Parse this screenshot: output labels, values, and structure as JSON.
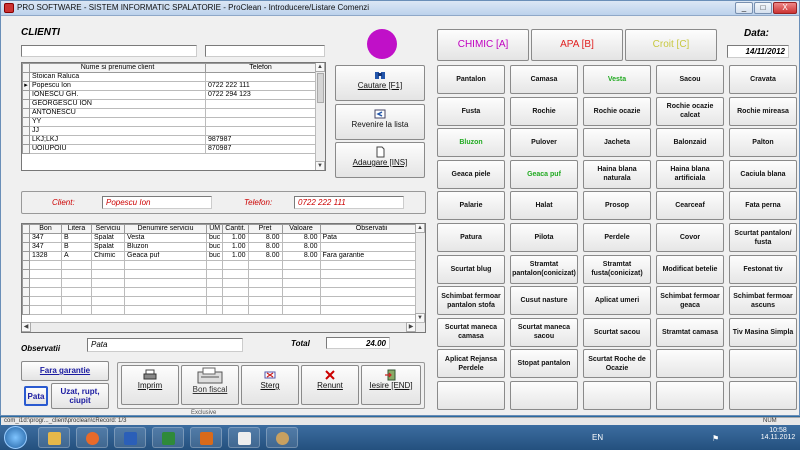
{
  "window": {
    "title": "PRO SOFTWARE - SISTEM INFORMATIC SPALATORIE - ProClean - Introducere/Listare Comenzi",
    "min": "_",
    "max": "□",
    "close": "X"
  },
  "clienti": {
    "title": "CLIENTI",
    "search1": "",
    "search2": "",
    "columns": [
      "Nume si prenume client",
      "Telefon"
    ],
    "rows": [
      {
        "name": "Stoican Raluca",
        "phone": ""
      },
      {
        "name": "Popescu Ion",
        "phone": "0722 222 111",
        "selected": true
      },
      {
        "name": "IONESCU GH.",
        "phone": "0722 294 123"
      },
      {
        "name": "GEORGESCU ION",
        "phone": ""
      },
      {
        "name": "ANTONESCU",
        "phone": ""
      },
      {
        "name": "YY",
        "phone": ""
      },
      {
        "name": "JJ",
        "phone": ""
      },
      {
        "name": "LKJ;LKJ",
        "phone": "987987"
      },
      {
        "name": "UOIUPOIU",
        "phone": "870987"
      }
    ],
    "btn_cautare": "Cautare [F1]",
    "btn_revenire": "Revenire la lista",
    "btn_adaugare": "Adaugare [INS]"
  },
  "client_info": {
    "client_label": "Client:",
    "client_value": "Popescu Ion",
    "telefon_label": "Telefon:",
    "telefon_value": "0722 222 111"
  },
  "orders": {
    "columns": [
      "Bon",
      "Litera",
      "Serviciu",
      "Denumire serviciu",
      "UM",
      "Cantit.",
      "Pret",
      "Valoare",
      "Observatii"
    ],
    "rows": [
      [
        "347",
        "B",
        "Spalat",
        "Vesta",
        "buc",
        "1.00",
        "8.00",
        "8.00",
        "Pata"
      ],
      [
        "347",
        "B",
        "Spalat",
        "Bluzon",
        "buc",
        "1.00",
        "8.00",
        "8.00",
        ""
      ],
      [
        "1328",
        "A",
        "Chimic",
        "Geaca puf",
        "buc",
        "1.00",
        "8.00",
        "8.00",
        "Fara garantie"
      ]
    ]
  },
  "observatii": {
    "label": "Observatii",
    "value": "Pata",
    "total_label": "Total",
    "total_value": "24.00"
  },
  "quick": {
    "fara_garantie": "Fara garantie",
    "pata": "Pata",
    "uzat": "Uzat, rupt, ciupit"
  },
  "actions": [
    "Imprim",
    "Bon fiscal",
    "Sterg",
    "Renunt",
    "Iesire [END]"
  ],
  "status_text": "Exclusive",
  "categories": [
    {
      "label": "CHIMIC [A]",
      "color": "#c000c0"
    },
    {
      "label": "APA [B]",
      "color": "#e02020"
    },
    {
      "label": "Croit [C]",
      "color": "#c8c840"
    }
  ],
  "data": {
    "label": "Data:",
    "value": "14/11/2012"
  },
  "services": [
    [
      {
        "t": "Pantalon"
      },
      {
        "t": "Camasa"
      },
      {
        "t": "Vesta",
        "g": true
      },
      {
        "t": "Sacou"
      },
      {
        "t": "Cravata"
      }
    ],
    [
      {
        "t": "Fusta"
      },
      {
        "t": "Rochie"
      },
      {
        "t": "Rochie ocazie"
      },
      {
        "t": "Rochie ocazie calcat"
      },
      {
        "t": "Rochie mireasa"
      }
    ],
    [
      {
        "t": "Bluzon",
        "g": true
      },
      {
        "t": "Pulover"
      },
      {
        "t": "Jacheta"
      },
      {
        "t": "Balonzaid"
      },
      {
        "t": "Palton"
      }
    ],
    [
      {
        "t": "Geaca piele"
      },
      {
        "t": "Geaca puf",
        "g": true
      },
      {
        "t": "Haina blana naturala"
      },
      {
        "t": "Haina blana artificiala"
      },
      {
        "t": "Caciula blana"
      }
    ],
    [
      {
        "t": "Palarie"
      },
      {
        "t": "Halat"
      },
      {
        "t": "Prosop"
      },
      {
        "t": "Cearceaf"
      },
      {
        "t": "Fata perna"
      }
    ],
    [
      {
        "t": "Patura"
      },
      {
        "t": "Pilota"
      },
      {
        "t": "Perdele"
      },
      {
        "t": "Covor"
      },
      {
        "t": "Scurtat pantalon/ fusta"
      }
    ],
    [
      {
        "t": "Scurtat blug"
      },
      {
        "t": "Stramtat pantalon(conicizat)"
      },
      {
        "t": "Stramtat fusta(conicizat)"
      },
      {
        "t": "Modificat betelie"
      },
      {
        "t": "Festonat tiv"
      }
    ],
    [
      {
        "t": "Schimbat fermoar pantalon stofa"
      },
      {
        "t": "Cusut nasture"
      },
      {
        "t": "Aplicat umeri"
      },
      {
        "t": "Schimbat fermoar geaca"
      },
      {
        "t": "Schimbat fermoar ascuns"
      }
    ],
    [
      {
        "t": "Scurtat maneca camasa"
      },
      {
        "t": "Scurtat maneca sacou"
      },
      {
        "t": "Scurtat sacou"
      },
      {
        "t": "Stramtat camasa"
      },
      {
        "t": "Tiv Masina Simpla"
      }
    ],
    [
      {
        "t": "Aplicat Rejansa Perdele"
      },
      {
        "t": "Stopat pantalon"
      },
      {
        "t": "Scurtat Roche de Ocazie"
      },
      {
        "t": ""
      },
      {
        "t": ""
      }
    ],
    [
      {
        "t": ""
      },
      {
        "t": ""
      },
      {
        "t": ""
      },
      {
        "t": ""
      },
      {
        "t": ""
      }
    ]
  ],
  "statusbar": {
    "left": "com_i1d:\\progr..._client\\proclean\\cRecord: 1/3",
    "right": "NUM"
  },
  "taskbar": {
    "lang": "EN",
    "time": "10:58",
    "date": "14.11.2012"
  }
}
